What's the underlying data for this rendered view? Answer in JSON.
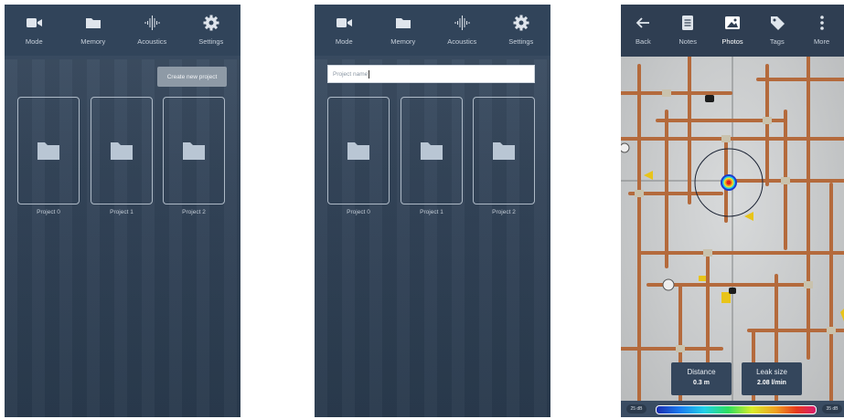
{
  "nav": {
    "mode": "Mode",
    "memory": "Memory",
    "acoustics": "Acoustics",
    "settings": "Settings"
  },
  "screen1": {
    "create_button": "Create new project"
  },
  "screen2": {
    "input_value": "Project name"
  },
  "projects": [
    "Project 0",
    "Project 1",
    "Project 2"
  ],
  "nav3": {
    "back": "Back",
    "notes": "Notes",
    "photos": "Photos",
    "tags": "Tags",
    "more": "More"
  },
  "measure": {
    "distance_label": "Distance",
    "distance_value": "0.3 m",
    "leak_label": "Leak size",
    "leak_value": "2.08 l/min"
  },
  "scale": {
    "min": "25 dB",
    "max": "35 dB"
  },
  "colors": {
    "nav_bg": "#31445a",
    "folder": "#b9c6d4",
    "card_border": "#aebac7",
    "create_button_bg": "#8e9aa6"
  }
}
